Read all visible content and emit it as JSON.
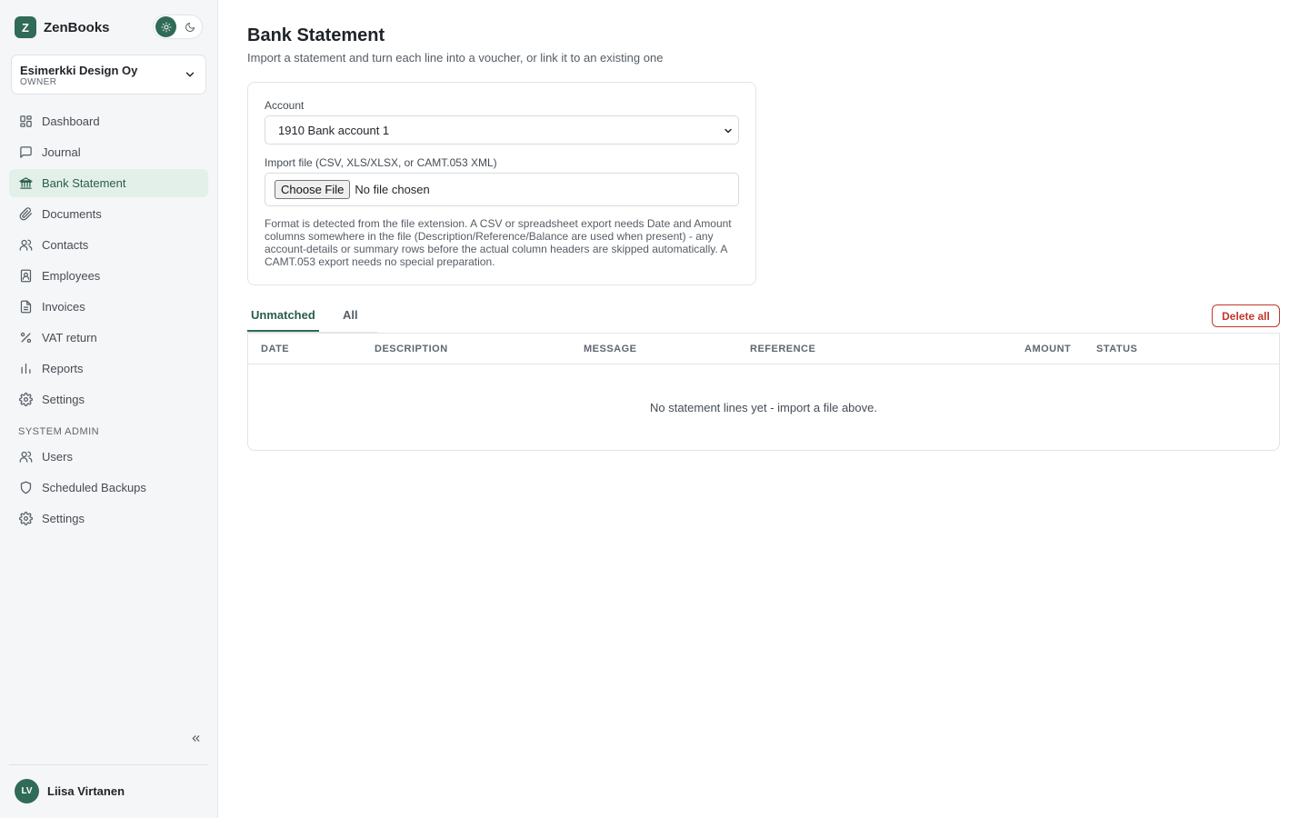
{
  "app": {
    "logo_letter": "Z",
    "name": "ZenBooks"
  },
  "theme": {
    "light_icon": "sun-icon",
    "dark_icon": "moon-icon",
    "active": "light"
  },
  "organization": {
    "name": "Esimerkki Design Oy",
    "role": "OWNER"
  },
  "nav": {
    "items": [
      {
        "label": "Dashboard",
        "icon": "dashboard-icon"
      },
      {
        "label": "Journal",
        "icon": "journal-icon"
      },
      {
        "label": "Bank Statement",
        "icon": "bank-icon",
        "active": true
      },
      {
        "label": "Documents",
        "icon": "paperclip-icon"
      },
      {
        "label": "Contacts",
        "icon": "contacts-icon"
      },
      {
        "label": "Employees",
        "icon": "employee-badge-icon"
      },
      {
        "label": "Invoices",
        "icon": "invoice-icon"
      },
      {
        "label": "VAT return",
        "icon": "percent-icon"
      },
      {
        "label": "Reports",
        "icon": "bar-chart-icon"
      },
      {
        "label": "Settings",
        "icon": "gear-icon"
      }
    ],
    "admin_section_label": "SYSTEM ADMIN",
    "admin_items": [
      {
        "label": "Users",
        "icon": "users-icon"
      },
      {
        "label": "Scheduled Backups",
        "icon": "shield-icon"
      },
      {
        "label": "Settings",
        "icon": "gear-icon"
      }
    ]
  },
  "user": {
    "initials": "LV",
    "name": "Liisa Virtanen"
  },
  "page": {
    "title": "Bank Statement",
    "subtitle": "Import a statement and turn each line into a voucher, or link it to an existing one"
  },
  "import": {
    "account_label": "Account",
    "account_value": "1910 Bank account 1",
    "file_label": "Import file (CSV, XLS/XLSX, or CAMT.053 XML)",
    "choose_button": "Choose File",
    "file_status": "No file chosen",
    "help": "Format is detected from the file extension. A CSV or spreadsheet export needs Date and Amount columns somewhere in the file (Description/Reference/Balance are used when present) - any account-details or summary rows before the actual column headers are skipped automatically. A CAMT.053 export needs no special preparation."
  },
  "tabs": [
    {
      "label": "Unmatched",
      "active": true
    },
    {
      "label": "All"
    }
  ],
  "delete_all_label": "Delete all",
  "table": {
    "columns": [
      "DATE",
      "DESCRIPTION",
      "MESSAGE",
      "REFERENCE",
      "AMOUNT",
      "STATUS"
    ],
    "empty_message": "No statement lines yet - import a file above."
  },
  "colors": {
    "accent": "#2f6b57",
    "danger": "#c0392b",
    "active_nav_bg": "#e3f0ea"
  }
}
